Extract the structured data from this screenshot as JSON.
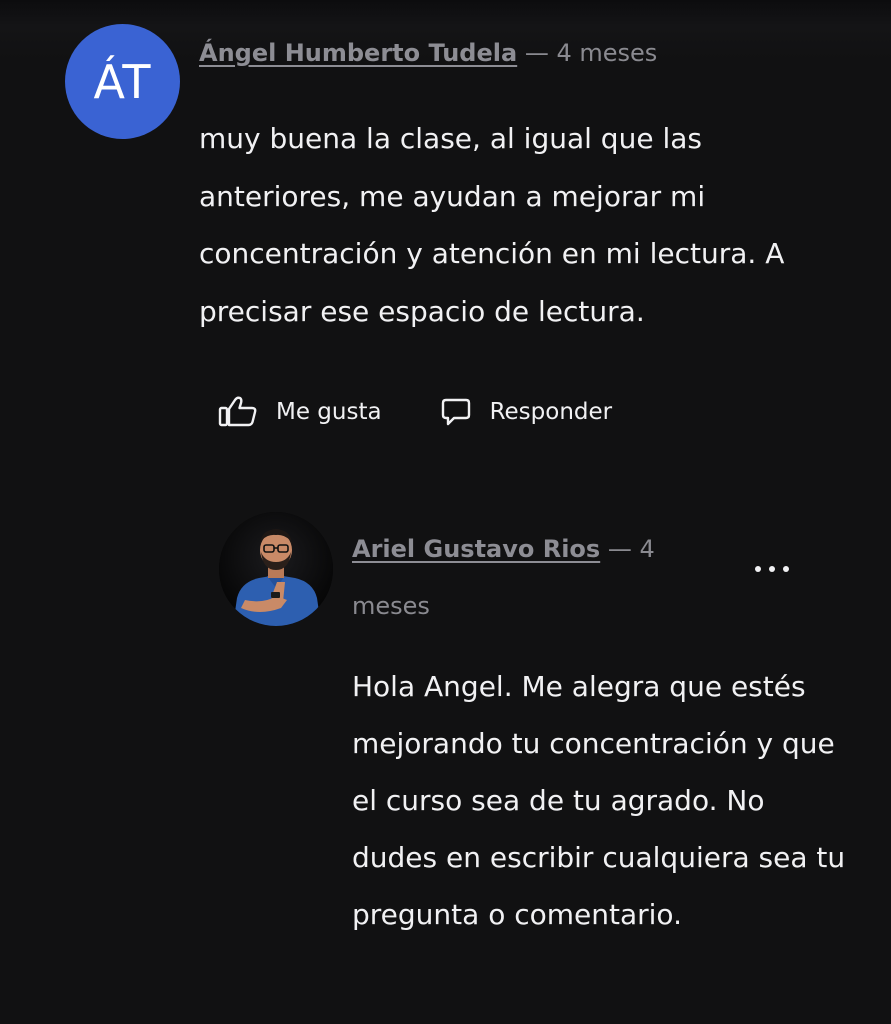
{
  "comment": {
    "author_initials": "ÁT",
    "author_name": "Ángel Humberto Tudela",
    "separator": "—",
    "time_ago": "4 meses",
    "body": "muy buena la clase, al igual que las anteriores, me ayudan a mejorar mi concentración y atención en mi lectura. A precisar ese espacio de lectura.",
    "avatar_color": "#3a63d3",
    "actions": {
      "like_label": "Me gusta",
      "like_icon": "thumbs-up-icon",
      "reply_label": "Responder",
      "reply_icon": "speech-bubble-icon"
    }
  },
  "reply": {
    "author_name": "Ariel Gustavo Rios",
    "separator": "—",
    "time_ago": "4 meses",
    "avatar_icon": "profile-photo",
    "more_icon": "more-options-icon",
    "body": "Hola Angel. Me alegra que estés mejorando tu concentración y que el curso sea de tu agrado. No dudes en escribir cualquiera sea tu pregunta o comentario."
  }
}
